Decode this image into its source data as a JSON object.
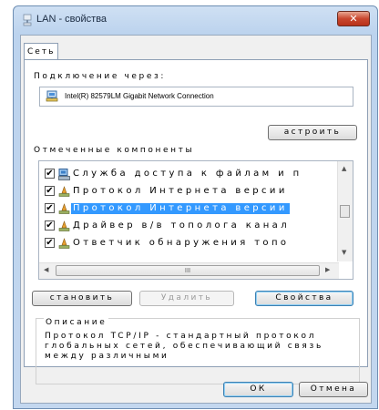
{
  "window": {
    "title": "LAN - свойства",
    "close_glyph": "✕"
  },
  "tabs": [
    {
      "label": "Сеть"
    }
  ],
  "connect_via": {
    "label": "Подключение через:",
    "adapter_name": "Intel(R) 82579LM Gigabit Network Connection",
    "configure_button": "астроить"
  },
  "components": {
    "label": "Отмеченные компоненты",
    "items": [
      {
        "label": "Служба доступа к файлам и п",
        "checked": true,
        "icon": "network-service-icon",
        "selected": false
      },
      {
        "label": "Протокол Интернета версии",
        "checked": true,
        "icon": "protocol-icon",
        "selected": false
      },
      {
        "label": "Протокол Интернета версии",
        "checked": true,
        "icon": "protocol-icon",
        "selected": true
      },
      {
        "label": "Драйвер в/в тополога канал",
        "checked": true,
        "icon": "protocol-icon",
        "selected": false
      },
      {
        "label": "Ответчик обнаружения топо",
        "checked": true,
        "icon": "protocol-icon",
        "selected": false
      }
    ],
    "hscroll_grip": "III"
  },
  "actions": {
    "install": "становить",
    "remove": "Удалить",
    "properties": "Свойства"
  },
  "description": {
    "title": "Описание",
    "text": "Протокол TCP/IP - стандартный протокол глобальных сетей, обеспечивающий связь между различными"
  },
  "footer": {
    "ok": "ОК",
    "cancel": "Отмена"
  },
  "colors": {
    "selection": "#3399ff",
    "close_button": "#c9472e",
    "window_frame": "#bcd3ee"
  }
}
